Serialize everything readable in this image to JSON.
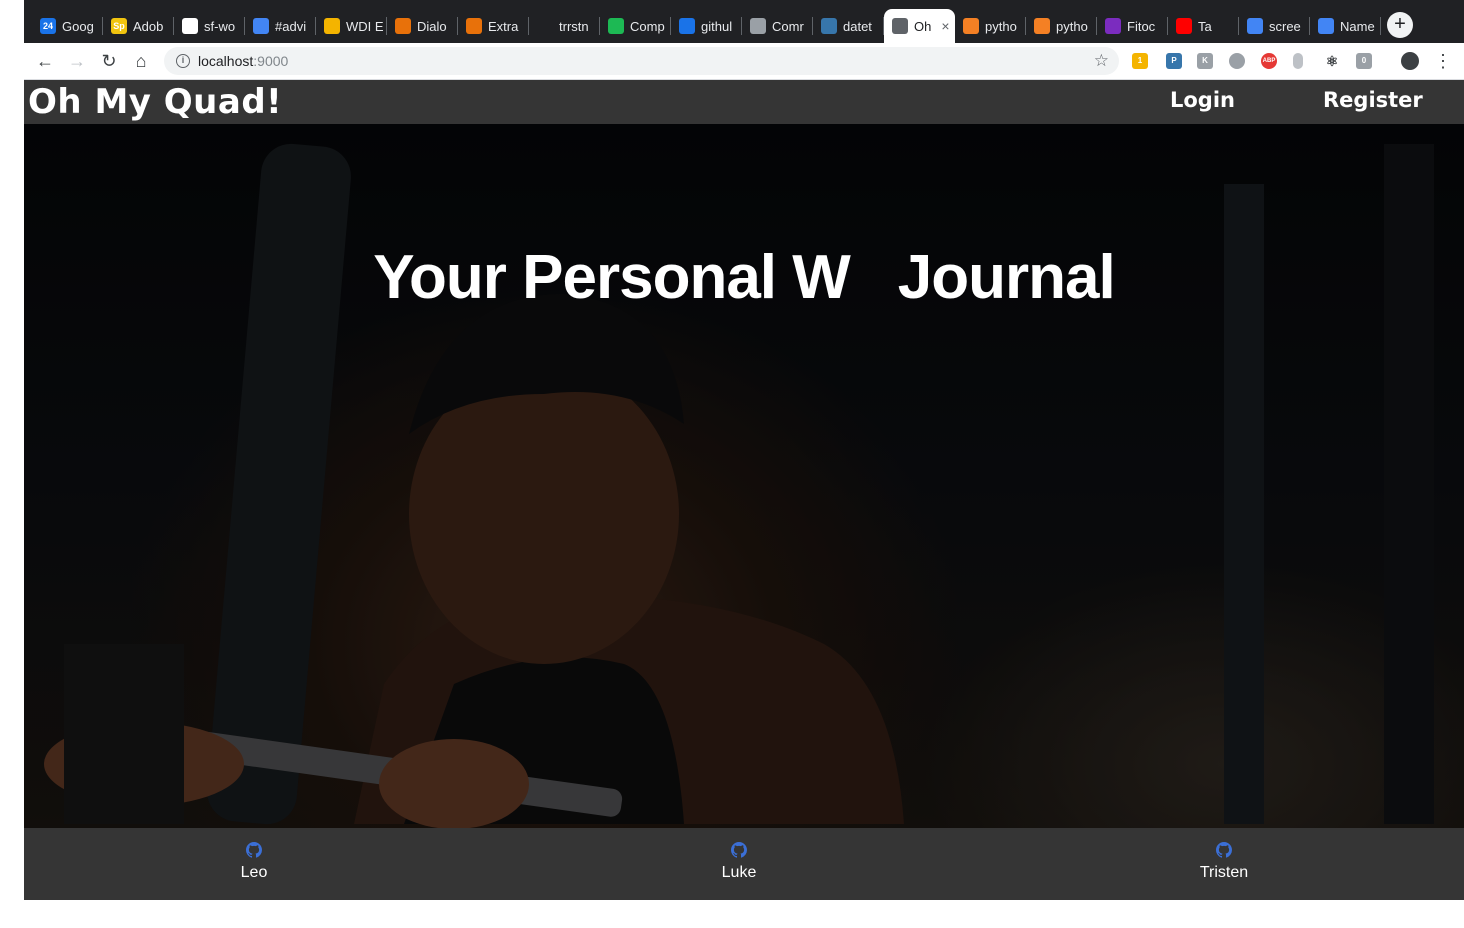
{
  "browser": {
    "tabs": [
      {
        "label": "Goog",
        "favicon": "calendar-icon",
        "badge": "24",
        "color": "#1a73e8"
      },
      {
        "label": "Adob",
        "favicon": "adobe-spark-icon",
        "badge": "Sp",
        "color": "#f1c40f"
      },
      {
        "label": "sf-wo",
        "favicon": "github-icon",
        "badge": "",
        "color": "#ffffff"
      },
      {
        "label": "#advi",
        "favicon": "slack-calendar-icon",
        "badge": "",
        "color": "#4285f4"
      },
      {
        "label": "WDI E",
        "favicon": "slides-icon",
        "badge": "",
        "color": "#f4b400"
      },
      {
        "label": "Dialo",
        "favicon": "hexagon-icon",
        "badge": "",
        "color": "#e8710a"
      },
      {
        "label": "Extra",
        "favicon": "hexagon-icon",
        "badge": "",
        "color": "#e8710a"
      },
      {
        "label": "trrstn",
        "favicon": "github-icon",
        "badge": "",
        "color": "#202124"
      },
      {
        "label": "Comp",
        "favicon": "d-icon",
        "badge": "",
        "color": "#1db954"
      },
      {
        "label": "githul",
        "favicon": "flag-icon",
        "badge": "",
        "color": "#1a73e8"
      },
      {
        "label": "Comr",
        "favicon": "grid-icon",
        "badge": "",
        "color": "#9aa0a6"
      },
      {
        "label": "datet",
        "favicon": "python-icon",
        "badge": "",
        "color": "#3776ab"
      },
      {
        "label": "Oh",
        "favicon": "page-icon",
        "badge": "",
        "color": "#5f6368",
        "active": true
      },
      {
        "label": "pytho",
        "favicon": "stackoverflow-icon",
        "badge": "",
        "color": "#f48024"
      },
      {
        "label": "pytho",
        "favicon": "stackoverflow-icon",
        "badge": "",
        "color": "#f48024"
      },
      {
        "label": "Fitoc",
        "favicon": "fitocracy-icon",
        "badge": "",
        "color": "#7b2cbf"
      },
      {
        "label": "Ta",
        "favicon": "youtube-icon",
        "badge": "",
        "color": "#ff0000"
      },
      {
        "label": "scree",
        "favicon": "google-icon",
        "badge": "",
        "color": "#4285f4"
      },
      {
        "label": "Name",
        "favicon": "google-icon",
        "badge": "",
        "color": "#4285f4"
      }
    ],
    "url_host": "localhost",
    "url_port": ":9000"
  },
  "site": {
    "brand": "Oh My Quad!",
    "nav": {
      "login": "Login",
      "register": "Register"
    },
    "hero": {
      "title_left": "Your Personal W",
      "title_right": "Journal"
    },
    "team": [
      {
        "name": "Leo",
        "icon": "github-icon"
      },
      {
        "name": "Luke",
        "icon": "github-icon"
      },
      {
        "name": "Tristen",
        "icon": "github-icon"
      }
    ],
    "colors": {
      "navbar": "#353535",
      "github_icon": "#3b6fd6"
    }
  }
}
